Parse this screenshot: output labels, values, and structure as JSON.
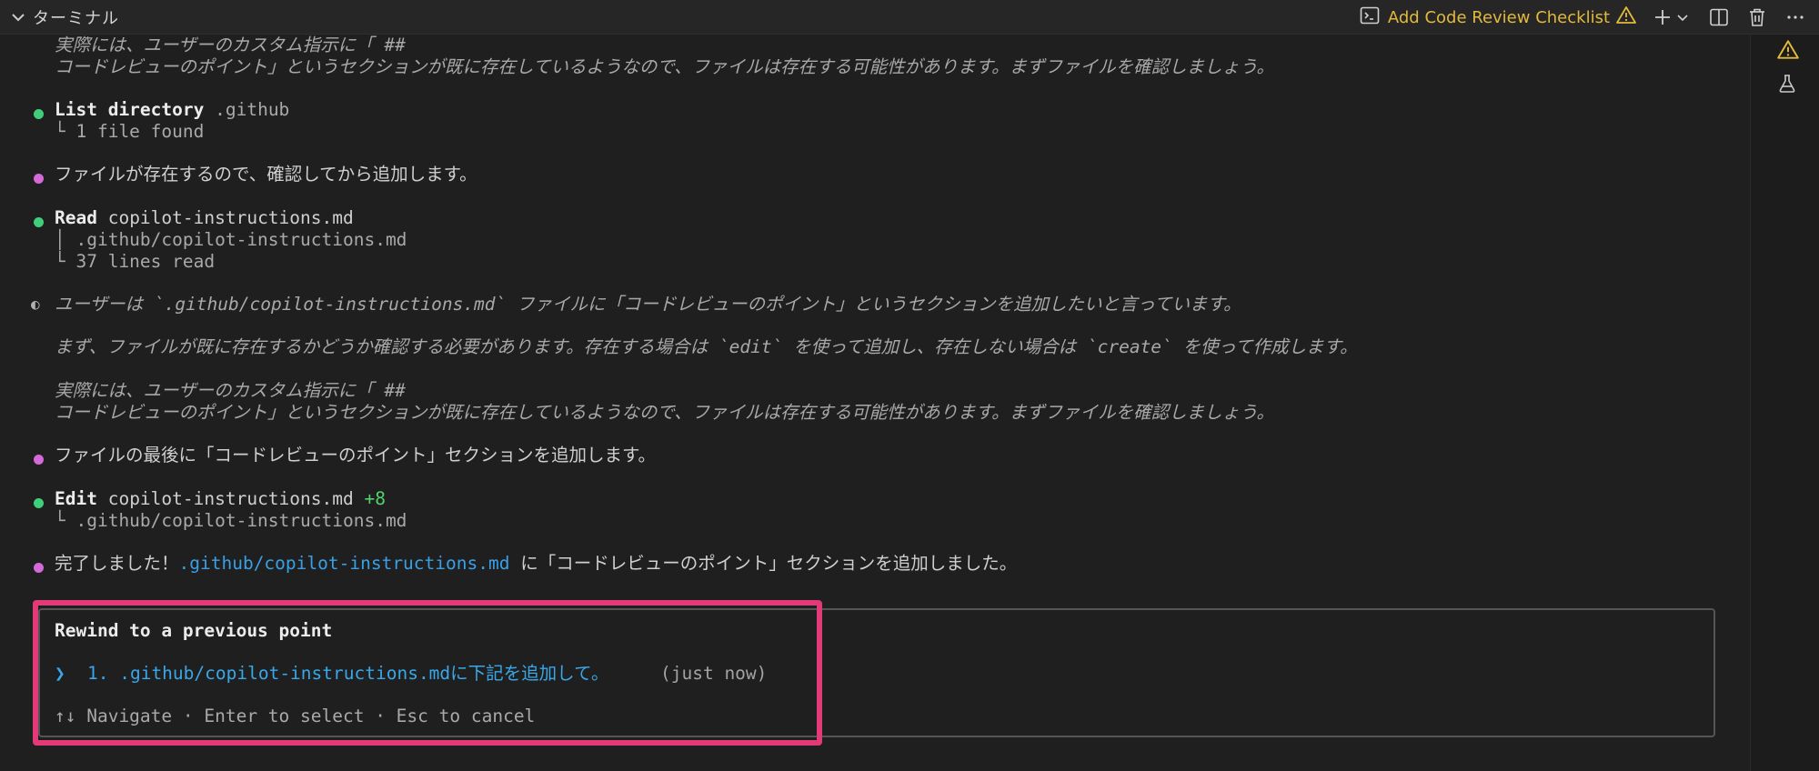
{
  "header": {
    "panel_title": "ターミナル",
    "task_label": "Add Code Review Checklist",
    "icons": [
      "chevron-down-icon",
      "terminal-icon",
      "warning-icon",
      "plus-icon",
      "dropdown-icon",
      "split-icon",
      "trash-icon",
      "more-icon"
    ],
    "accent": "#e2b93d"
  },
  "gutter": {
    "icons": [
      "warning-icon",
      "flask-icon"
    ]
  },
  "terminal": {
    "l1": "実際には、ユーザーのカスタム指示に「 ##",
    "l2": "コードレビューのポイント」というセクションが既に存在しているようなので、ファイルは存在する可能性があります。まずファイルを確認しましょう。",
    "list_tool": "List directory",
    "list_arg": " .github",
    "list_result": "└ 1 file found",
    "msg1": "ファイルが存在するので、確認してから追加します。",
    "read_tool": "Read",
    "read_arg": " copilot-instructions.md",
    "read_path": "│ .github/copilot-instructions.md",
    "read_result": "└ 37 lines read",
    "think1": "ユーザーは `.github/copilot-instructions.md` ファイルに「コードレビューのポイント」というセクションを追加したいと言っています。",
    "think2": "まず、ファイルが既に存在するかどうか確認する必要があります。存在する場合は `edit` を使って追加し、存在しない場合は `create` を使って作成します。",
    "think3": "実際には、ユーザーのカスタム指示に「 ##",
    "think4": "コードレビューのポイント」というセクションが既に存在しているようなので、ファイルは存在する可能性があります。まずファイルを確認しましょう。",
    "msg2": "ファイルの最後に「コードレビューのポイント」セクションを追加します。",
    "edit_tool": "Edit",
    "edit_arg": " copilot-instructions.md ",
    "edit_plus": "+8",
    "edit_result": "└ .github/copilot-instructions.md",
    "done_prefix": "完了しました！",
    "done_link": ".github/copilot-instructions.md",
    "done_suffix": " に「コードレビューのポイント」セクションを追加しました。"
  },
  "rewind": {
    "title": "Rewind to a previous point",
    "caret": "❯",
    "option": "1. .github/copilot-instructions.mdに下記を追加して。",
    "time": "(just now)",
    "help": "↑↓ Navigate · Enter to select · Esc to cancel",
    "highlight_color": "#e13a77"
  },
  "colors": {
    "success_dot": "#3fcf7a",
    "message_dot": "#d46ad8",
    "link": "#3aa0e6"
  }
}
